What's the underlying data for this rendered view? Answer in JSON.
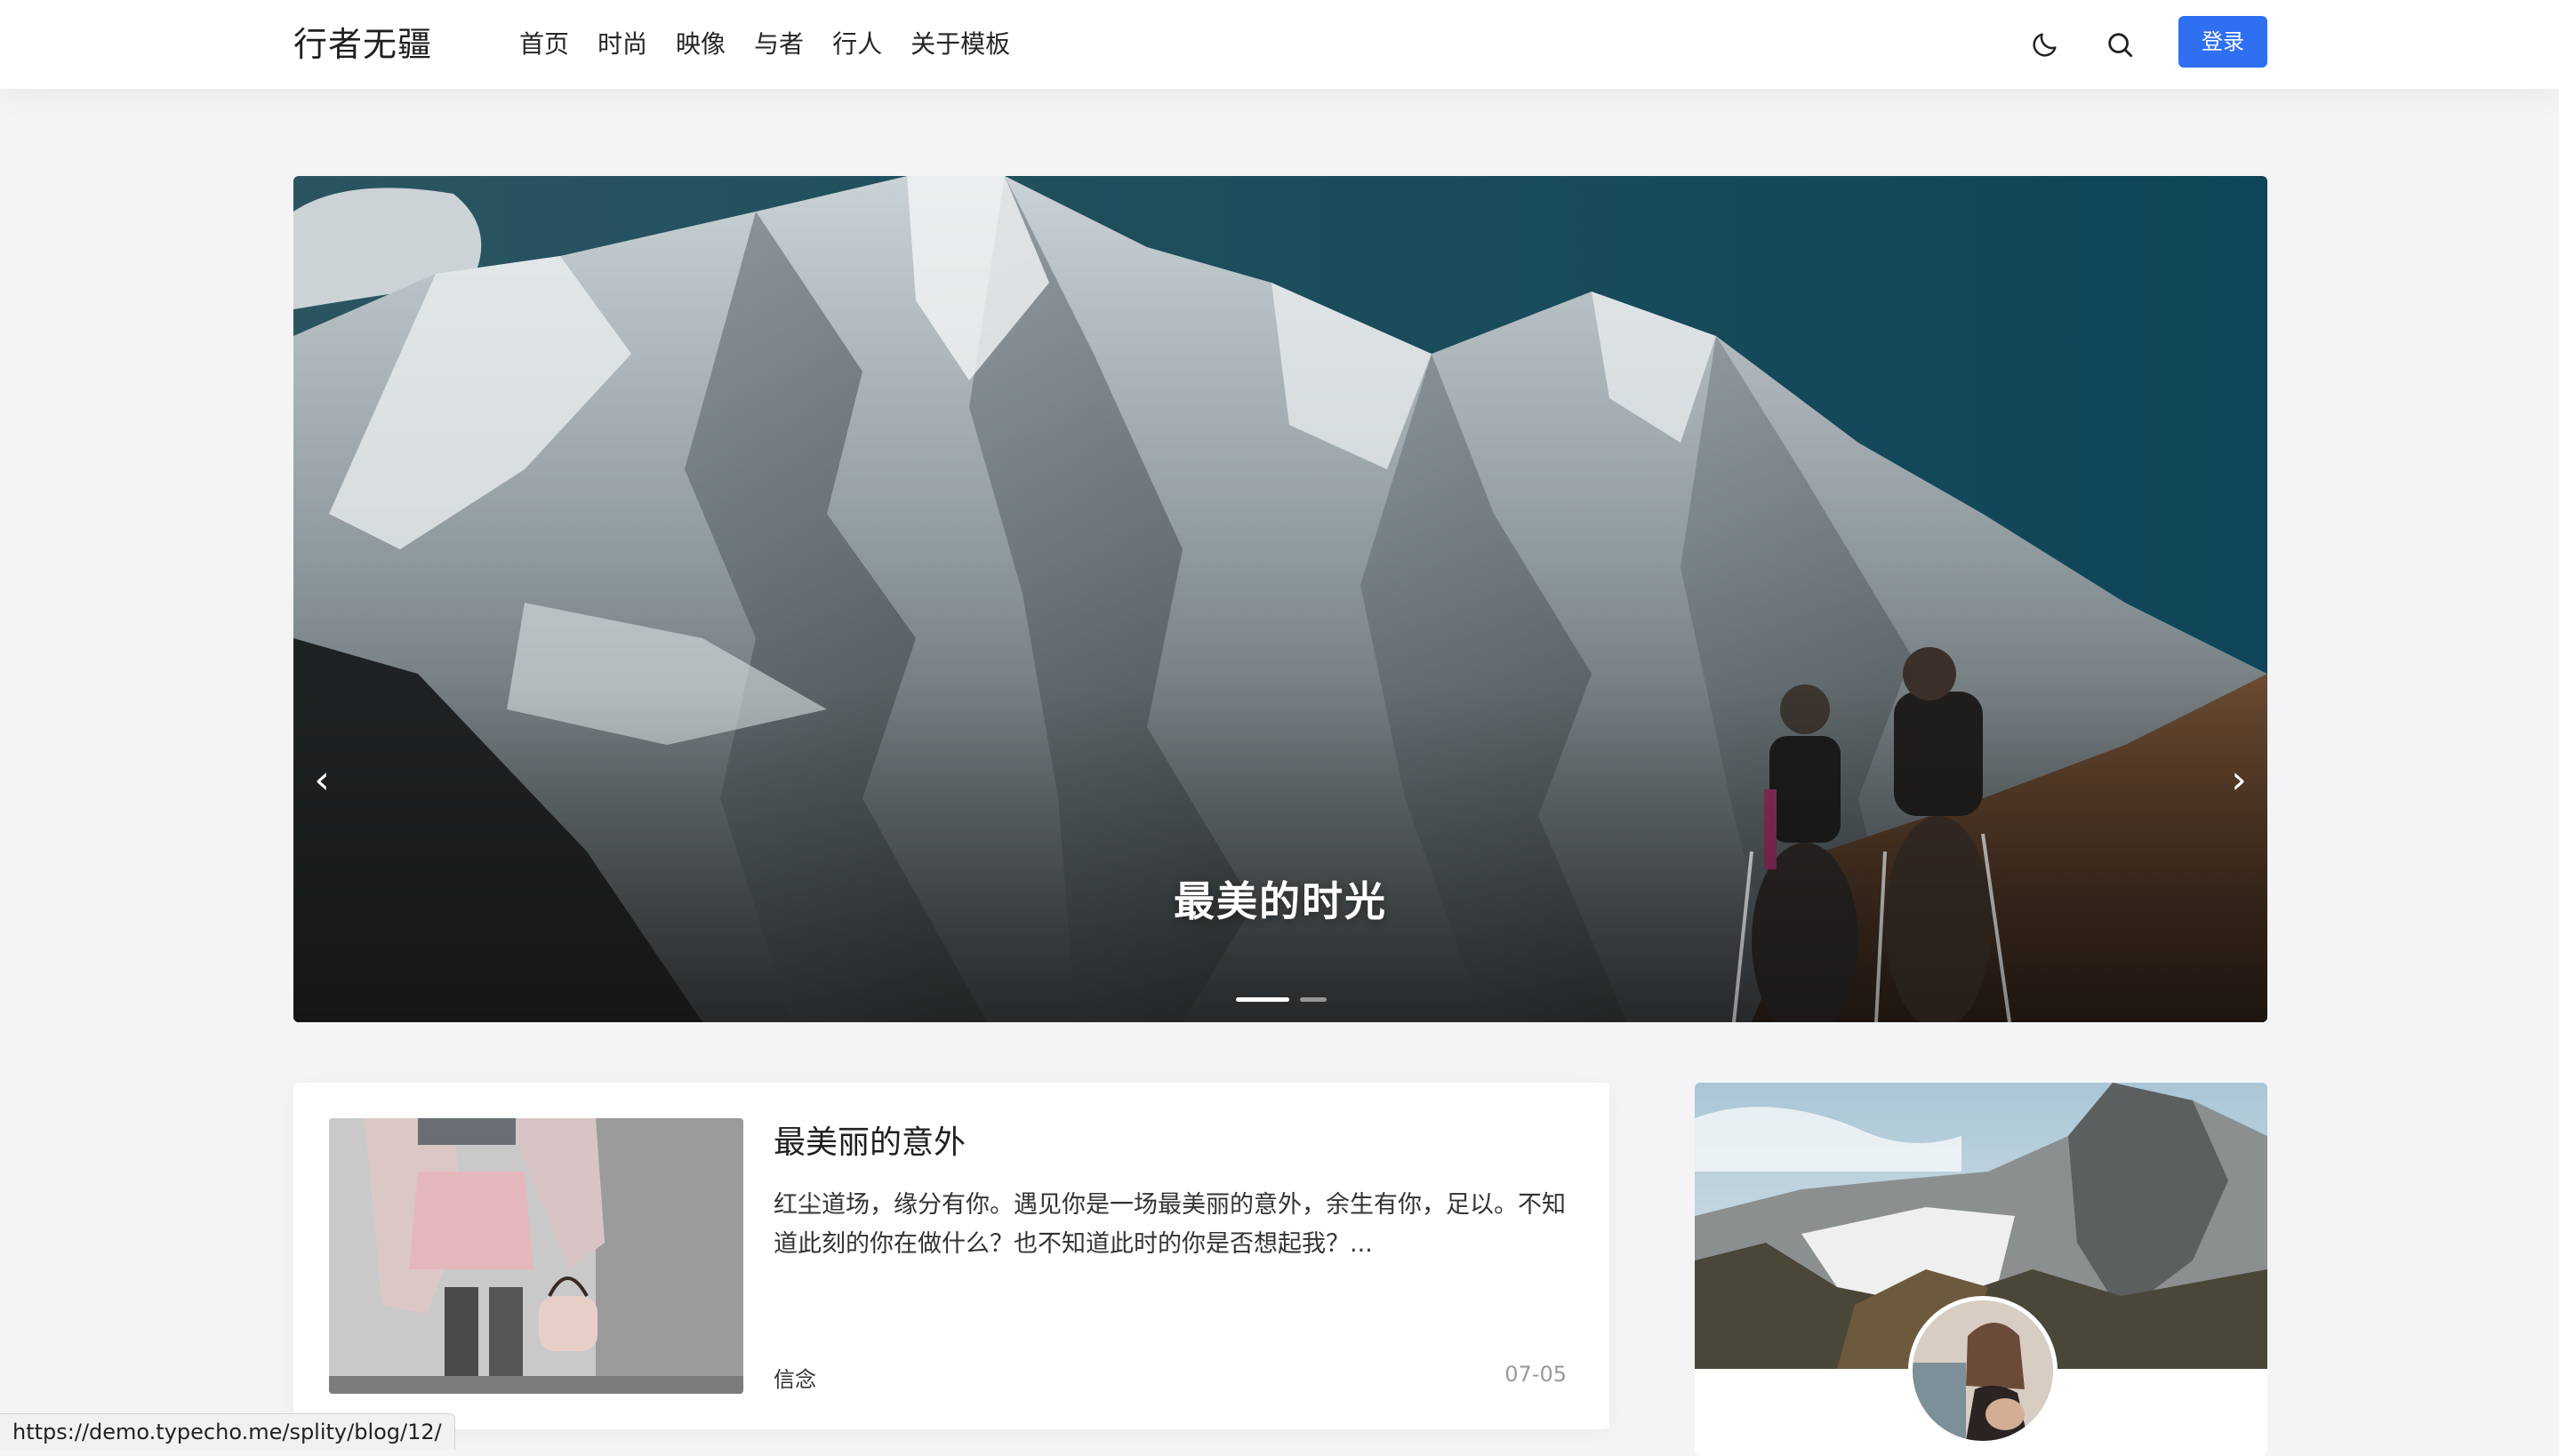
{
  "header": {
    "logo": "行者无疆",
    "nav": [
      "首页",
      "时尚",
      "映像",
      "与者",
      "行人",
      "关于模板"
    ],
    "icons": [
      "moon-icon",
      "search-icon"
    ],
    "login_label": "登录",
    "accent": "#2f6ff2"
  },
  "hero": {
    "title": "最美的时光",
    "prev_glyph": "‹",
    "next_glyph": "›",
    "slide_count": 2,
    "active_slide": 1
  },
  "post": {
    "title": "最美丽的意外",
    "excerpt": "红尘道场，缘分有你。遇见你是一场最美丽的意外，余生有你，足以。不知道此刻的你在做什么？也不知道此时的你是否想起我？...",
    "tag": "信念",
    "date": "07-05"
  },
  "status_bar": {
    "url": "https://demo.typecho.me/splity/blog/12/"
  }
}
